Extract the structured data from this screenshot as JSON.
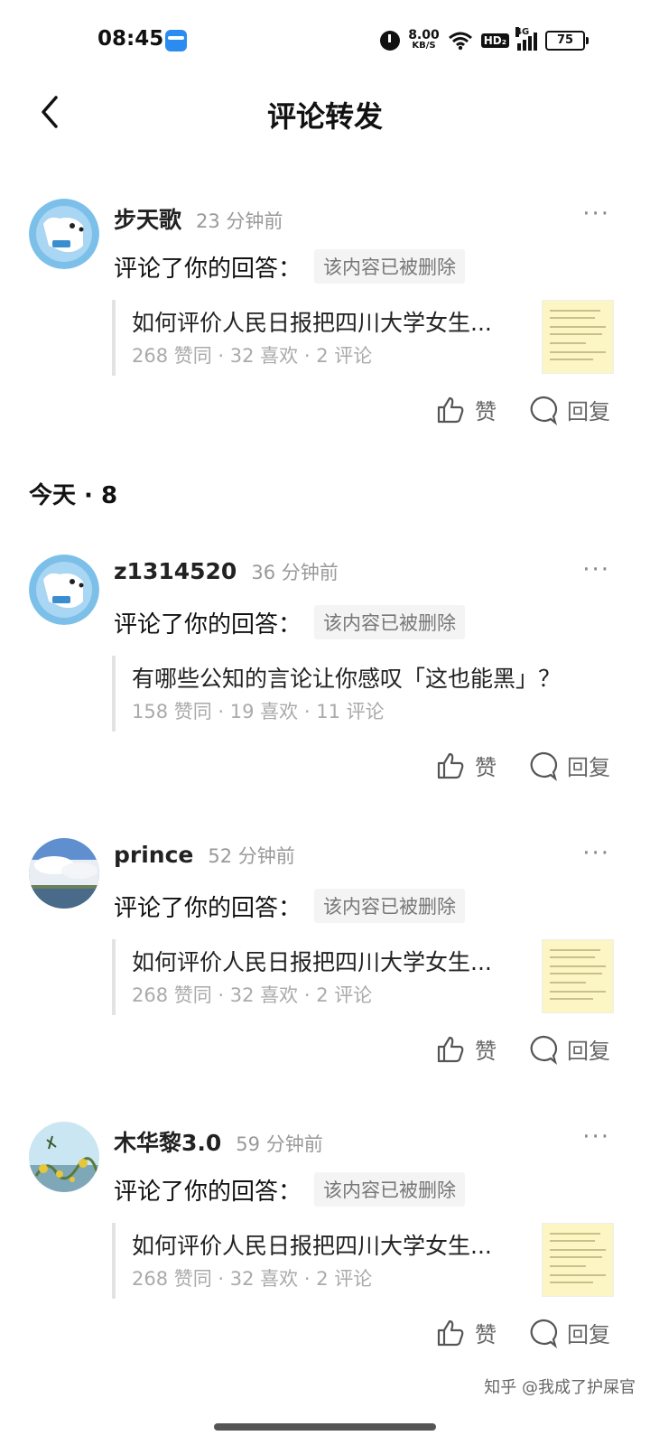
{
  "status_bar": {
    "time": "08:45",
    "net_speed": "8.00",
    "net_unit": "KB/S",
    "hd": "HD₂",
    "signal": "4G",
    "battery": "75"
  },
  "header": {
    "title": "评论转发"
  },
  "section": {
    "today": "今天 · 8"
  },
  "notifications": [
    {
      "user": "步天歌",
      "time": "23 分钟前",
      "action": "评论了你的回答：",
      "deleted": "该内容已被删除",
      "title": "如何评价人民日报把四川大学女生...",
      "stats": "268 赞同 · 32 喜欢 · 2 评论",
      "like": "赞",
      "reply": "回复"
    },
    {
      "user": "z1314520",
      "time": "36 分钟前",
      "action": "评论了你的回答：",
      "deleted": "该内容已被删除",
      "title": "有哪些公知的言论让你感叹「这也能黑」？",
      "stats": "158 赞同 · 19 喜欢 · 11 评论",
      "like": "赞",
      "reply": "回复"
    },
    {
      "user": "prince",
      "time": "52 分钟前",
      "action": "评论了你的回答：",
      "deleted": "该内容已被删除",
      "title": "如何评价人民日报把四川大学女生...",
      "stats": "268 赞同 · 32 喜欢 · 2 评论",
      "like": "赞",
      "reply": "回复"
    },
    {
      "user": "木华黎3.0",
      "time": "59 分钟前",
      "action": "评论了你的回答：",
      "deleted": "该内容已被删除",
      "title": "如何评价人民日报把四川大学女生...",
      "stats": "268 赞同 · 32 喜欢 · 2 评论",
      "like": "赞",
      "reply": "回复"
    }
  ],
  "more_glyph": "···",
  "watermark": "知乎 @我成了护屎官"
}
